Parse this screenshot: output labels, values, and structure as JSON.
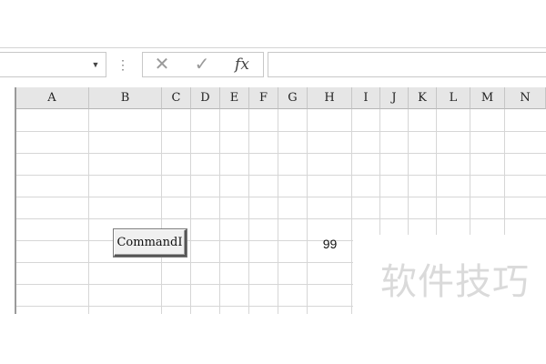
{
  "formula_bar": {
    "name_box_value": "",
    "cancel_icon": "✕",
    "enter_icon": "✓",
    "fx_label": "fx",
    "formula_value": ""
  },
  "columns": [
    "A",
    "B",
    "C",
    "D",
    "E",
    "F",
    "G",
    "H",
    "I",
    "J",
    "K",
    "L",
    "M",
    "N"
  ],
  "command_button": {
    "label": "CommandI"
  },
  "cell_value": "99",
  "watermark": "软件技巧"
}
